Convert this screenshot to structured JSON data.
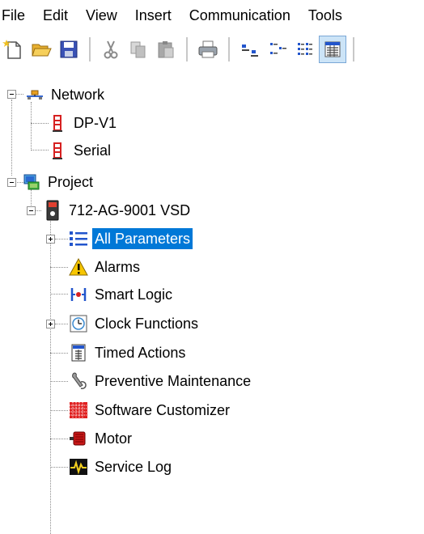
{
  "menu": [
    "File",
    "Edit",
    "View",
    "Insert",
    "Communication",
    "Tools"
  ],
  "tree": {
    "network": "Network",
    "dp_v1": "DP-V1",
    "serial": "Serial",
    "project": "Project",
    "drive": "712-AG-9001 VSD",
    "items": [
      {
        "label": "All Parameters",
        "icon": "list-icon"
      },
      {
        "label": "Alarms",
        "icon": "warning-icon"
      },
      {
        "label": "Smart Logic",
        "icon": "smart-logic-icon"
      },
      {
        "label": "Clock Functions",
        "icon": "clock-icon"
      },
      {
        "label": "Timed Actions",
        "icon": "timed-actions-icon"
      },
      {
        "label": "Preventive Maintenance",
        "icon": "wrench-icon"
      },
      {
        "label": "Software Customizer",
        "icon": "grid-icon"
      },
      {
        "label": "Motor",
        "icon": "motor-icon"
      },
      {
        "label": "Service Log",
        "icon": "service-log-icon"
      }
    ]
  },
  "colors": {
    "selection": "#0078d7",
    "accent_red": "#d62020"
  }
}
